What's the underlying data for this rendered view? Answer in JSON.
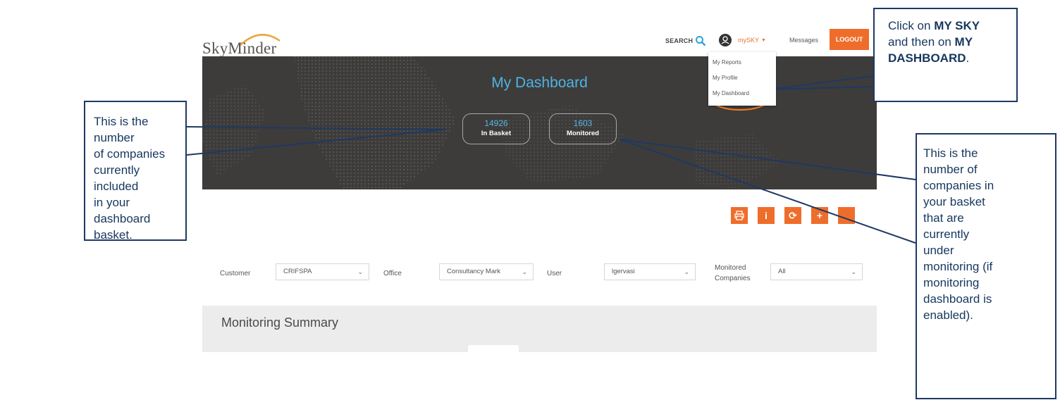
{
  "header": {
    "logo_text": "SkyMinder",
    "search_label": "SEARCH",
    "user_menu_label": "mySKY",
    "messages_label": "Messages",
    "logout_label": "LOGOUT"
  },
  "dropdown": {
    "items": [
      "My Reports",
      "My Profile",
      "My Dashboard"
    ]
  },
  "hero": {
    "title": "My Dashboard",
    "stats": [
      {
        "value": "14926",
        "label": "In Basket"
      },
      {
        "value": "1603",
        "label": "Monitored"
      }
    ]
  },
  "filters": {
    "customer_label": "Customer",
    "customer_value": "CRIFSPA",
    "office_label": "Office",
    "office_value": "Consultancy Mark",
    "user_label": "User",
    "user_value": "lgervasi",
    "monitored_label_1": "Monitored",
    "monitored_label_2": "Companies",
    "monitored_value": "All"
  },
  "summary": {
    "title": "Monitoring Summary"
  },
  "callouts": {
    "left": [
      "This is the number",
      "of companies",
      "currently included",
      "in your dashboard",
      "basket."
    ],
    "top": {
      "line1": "Click on ",
      "bold1": "MY SKY",
      "line2": "and then on ",
      "bold2": "MY",
      "bold3": "DASHBOARD",
      "end": "."
    },
    "right": [
      "This is the",
      "number of",
      "companies in",
      "your basket",
      "that are",
      "currently",
      "under",
      "monitoring (if",
      "monitoring",
      "dashboard is",
      "enabled)."
    ]
  },
  "colors": {
    "accent_orange": "#ef6d2b",
    "accent_blue": "#4fb3e5",
    "hero_bg": "#3d3c3a",
    "callout_border": "#1f3864"
  },
  "icons": [
    "search-icon",
    "user-icon",
    "print-icon",
    "info-icon",
    "refresh-icon",
    "add-icon"
  ]
}
